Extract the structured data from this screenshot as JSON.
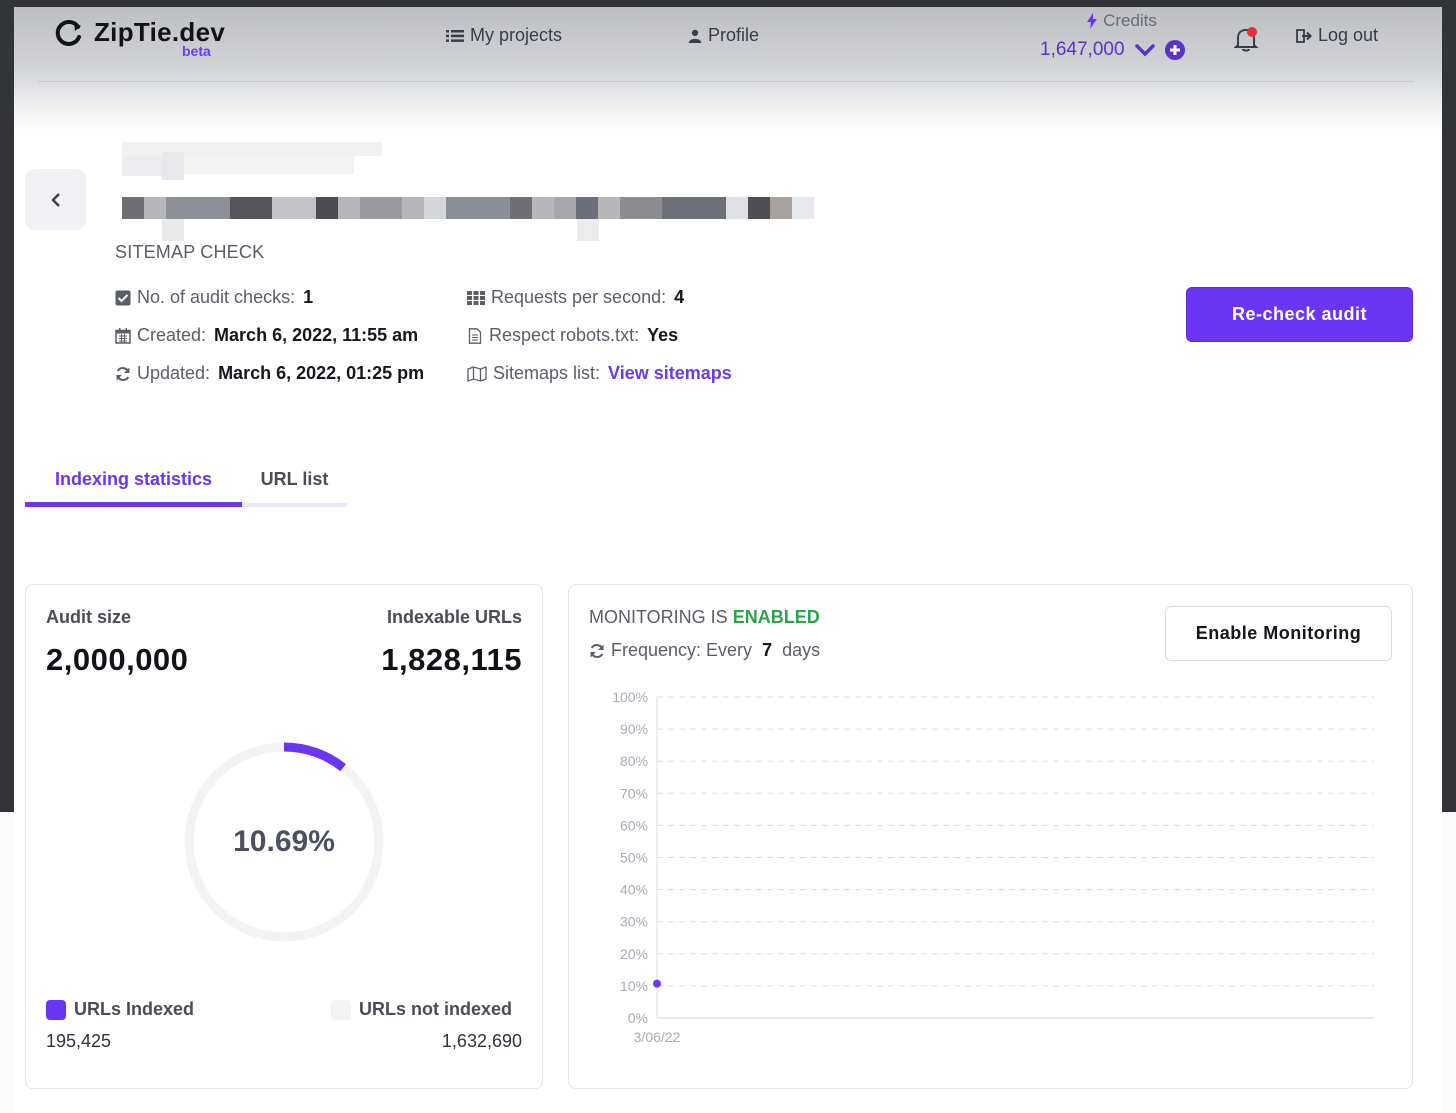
{
  "header": {
    "logo_text": "ZipTie.dev",
    "logo_badge": "beta",
    "nav": {
      "my_projects": "My projects",
      "profile": "Profile",
      "logout": "Log out"
    },
    "credits": {
      "label": "Credits",
      "value": "1,647,000"
    }
  },
  "project": {
    "audit_type": "SITEMAP CHECK",
    "meta": {
      "audit_checks_label": "No. of audit checks:",
      "audit_checks_value": "1",
      "created_label": "Created:",
      "created_value": "March 6, 2022, 11:55 am",
      "updated_label": "Updated:",
      "updated_value": "March 6, 2022, 01:25 pm",
      "rps_label": "Requests per second:",
      "rps_value": "4",
      "robots_label": "Respect robots.txt:",
      "robots_value": "Yes",
      "sitemaps_label": "Sitemaps list:",
      "sitemaps_link": "View sitemaps"
    },
    "recheck_button": "Re-check audit"
  },
  "tabs": [
    {
      "label": "Indexing statistics",
      "active": true
    },
    {
      "label": "URL list",
      "active": false
    }
  ],
  "stats": {
    "audit_size_label": "Audit size",
    "audit_size_value": "2,000,000",
    "indexable_label": "Indexable URLs",
    "indexable_value": "1,828,115",
    "indexed_percent_text": "10.69%",
    "indexed_fraction": 0.1069,
    "indexed_label": "URLs Indexed",
    "indexed_value": "195,425",
    "not_indexed_label": "URLs not indexed",
    "not_indexed_value": "1,632,690"
  },
  "monitoring": {
    "status_prefix": "MONITORING IS",
    "status_value": "ENABLED",
    "frequency_prefix": "Frequency: Every",
    "frequency_value": "7",
    "frequency_suffix": "days",
    "button": "Enable Monitoring"
  },
  "colors": {
    "accent": "#6a36f3",
    "enabled": "#29a44a",
    "not_indexed": "#f3f3f6"
  },
  "chart_data": {
    "type": "line",
    "title": "",
    "xlabel": "",
    "ylabel": "",
    "ylim": [
      0,
      100
    ],
    "y_ticks": [
      "0%",
      "10%",
      "20%",
      "30%",
      "40%",
      "50%",
      "60%",
      "70%",
      "80%",
      "90%",
      "100%"
    ],
    "x": [
      "3/06/22"
    ],
    "series": [
      {
        "values": [
          10.69
        ]
      }
    ],
    "grid": "dashed horizontal"
  }
}
